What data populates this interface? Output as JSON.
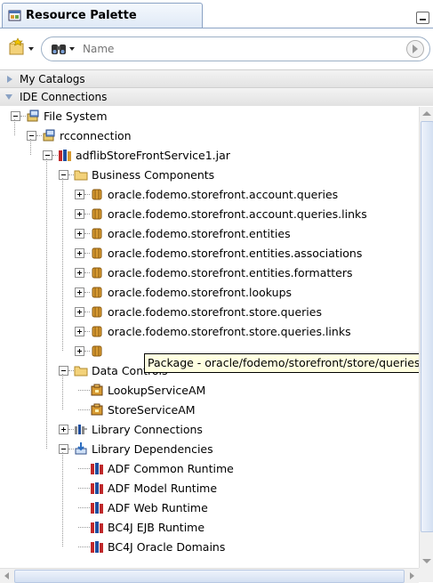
{
  "panel": {
    "title": "Resource Palette"
  },
  "search": {
    "placeholder": "Name",
    "value": ""
  },
  "accordion": {
    "my_catalogs": "My Catalogs",
    "ide_connections": "IDE Connections"
  },
  "tree": [
    {
      "label": "File System",
      "icon": "file-system-icon",
      "state": "expanded",
      "level": 0
    },
    {
      "label": "rcconnection",
      "icon": "file-system-icon",
      "state": "expanded",
      "level": 1
    },
    {
      "label": "adflibStoreFrontService1.jar",
      "icon": "jar-library-icon",
      "state": "expanded",
      "level": 2
    },
    {
      "label": "Business Components",
      "icon": "folder-icon",
      "state": "expanded",
      "level": 3
    },
    {
      "label": "oracle.fodemo.storefront.account.queries",
      "icon": "package-icon",
      "state": "collapsed",
      "level": 4
    },
    {
      "label": "oracle.fodemo.storefront.account.queries.links",
      "icon": "package-icon",
      "state": "collapsed",
      "level": 4
    },
    {
      "label": "oracle.fodemo.storefront.entities",
      "icon": "package-icon",
      "state": "collapsed",
      "level": 4
    },
    {
      "label": "oracle.fodemo.storefront.entities.associations",
      "icon": "package-icon",
      "state": "collapsed",
      "level": 4
    },
    {
      "label": "oracle.fodemo.storefront.entities.formatters",
      "icon": "package-icon",
      "state": "collapsed",
      "level": 4
    },
    {
      "label": "oracle.fodemo.storefront.lookups",
      "icon": "package-icon",
      "state": "collapsed",
      "level": 4
    },
    {
      "label": "oracle.fodemo.storefront.store.queries",
      "icon": "package-icon",
      "state": "collapsed",
      "level": 4
    },
    {
      "label": "oracle.fodemo.storefront.store.queries.links",
      "icon": "package-icon",
      "state": "collapsed",
      "level": 4
    },
    {
      "label": "",
      "icon": "package-icon",
      "state": "collapsed",
      "level": 4
    },
    {
      "label": "Data Controls",
      "icon": "folder-icon",
      "state": "expanded",
      "level": 3
    },
    {
      "label": "LookupServiceAM",
      "icon": "data-control-icon",
      "state": "leaf",
      "level": 4
    },
    {
      "label": "StoreServiceAM",
      "icon": "data-control-icon",
      "state": "leaf",
      "level": 4
    },
    {
      "label": "Library Connections",
      "icon": "library-connection-icon",
      "state": "collapsed",
      "level": 3
    },
    {
      "label": "Library Dependencies",
      "icon": "dependency-icon",
      "state": "expanded",
      "level": 3
    },
    {
      "label": "ADF Common Runtime",
      "icon": "library-icon",
      "state": "leaf",
      "level": 4
    },
    {
      "label": "ADF Model Runtime",
      "icon": "library-icon",
      "state": "leaf",
      "level": 4
    },
    {
      "label": "ADF Web Runtime",
      "icon": "library-icon",
      "state": "leaf",
      "level": 4
    },
    {
      "label": "BC4J EJB Runtime",
      "icon": "library-icon",
      "state": "leaf",
      "level": 4
    },
    {
      "label": "BC4J Oracle Domains",
      "icon": "library-icon",
      "state": "leaf",
      "level": 4
    }
  ],
  "tooltip": {
    "text": "Package - oracle/fodemo/storefront/store/queries/"
  },
  "colors": {
    "accent": "#8aa2c4",
    "tooltip_bg": "#ffffe1",
    "package": "#d79a32"
  }
}
